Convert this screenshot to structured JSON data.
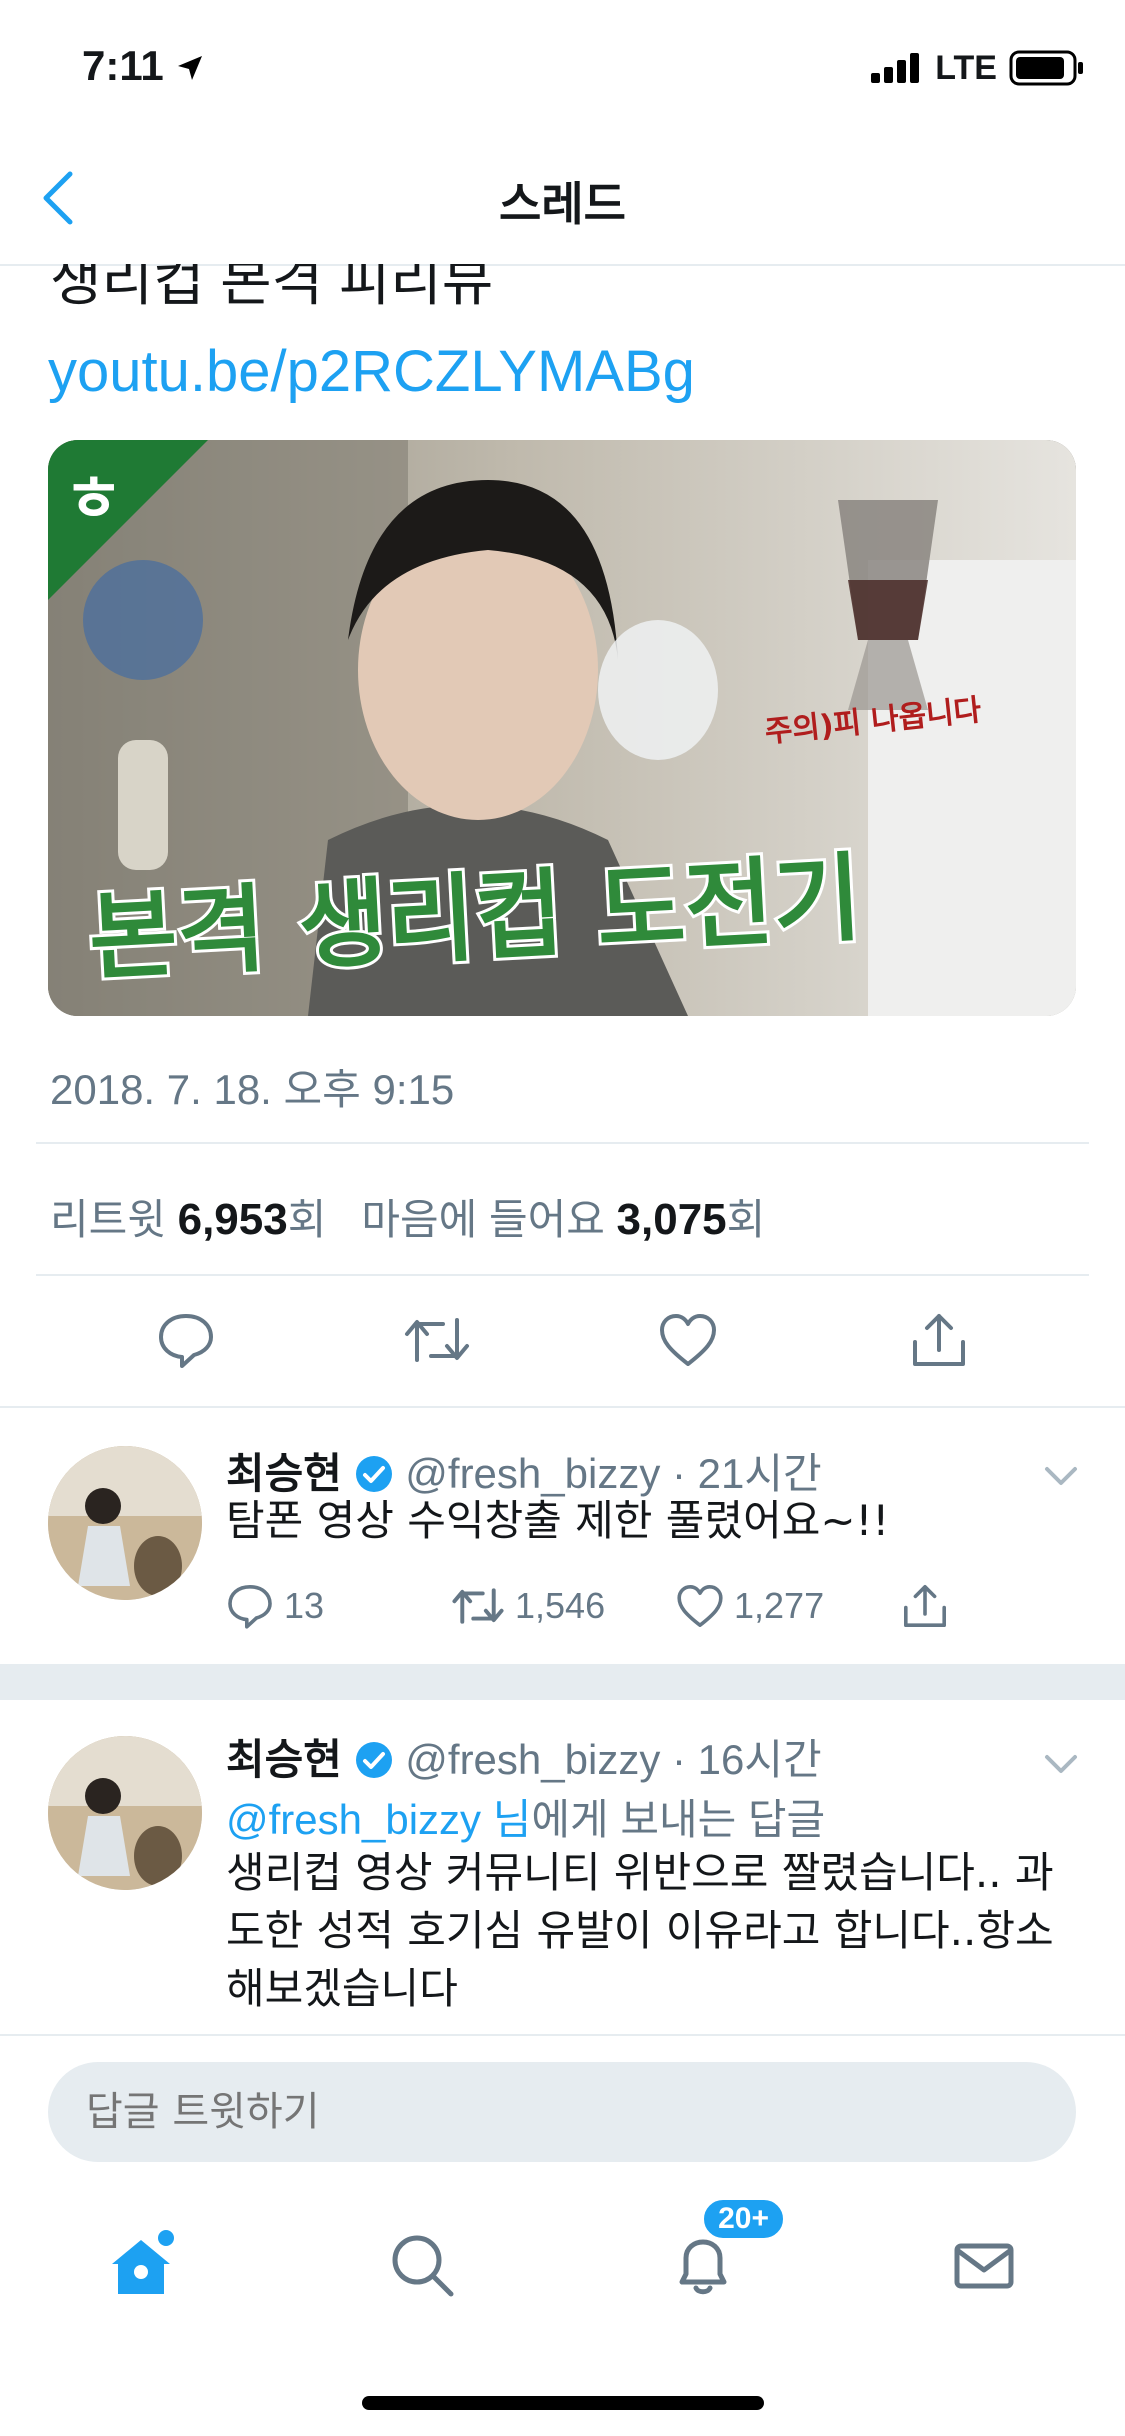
{
  "status_bar": {
    "time": "7:11",
    "network": "LTE"
  },
  "nav": {
    "title": "스레드"
  },
  "tweet": {
    "text_partial": "생리컵 본격 피리뷰",
    "link": "youtu.be/p2RCZLYMABg",
    "media": {
      "corner_badge": "ㅎ",
      "caption": "본격 생리컵 도전기",
      "warning": "주의)피 나옵니다"
    },
    "timestamp": "2018. 7. 18. 오후 9:15",
    "stats": {
      "retweets_label": "리트윗",
      "retweets_count": "6,953",
      "likes_label": "마음에 들어요",
      "likes_count": "3,075",
      "unit": "회"
    }
  },
  "replies": [
    {
      "name": "최승현",
      "handle": "@fresh_bizzy",
      "time": "· 21시간",
      "text": "탐폰 영상 수익창출 제한 풀렸어요~!!",
      "replies": "13",
      "retweets": "1,546",
      "likes": "1,277"
    },
    {
      "name": "최승현",
      "handle": "@fresh_bizzy",
      "time": "· 16시간",
      "reply_to_handle": "@fresh_bizzy 님",
      "reply_to_suffix": "에게 보내는 답글",
      "text": "생리컵 영상 커뮤니티 위반으로 짤렸습니다.. 과도한 성적 호기심 유발이 이유라고 합니다..항소해보겠습니다"
    }
  ],
  "compose": {
    "placeholder": "답글 트윗하기"
  },
  "tabbar": {
    "notifications_badge": "20+"
  },
  "colors": {
    "accent": "#1da1f2",
    "muted": "#657786",
    "divider": "#e6ecf0"
  }
}
